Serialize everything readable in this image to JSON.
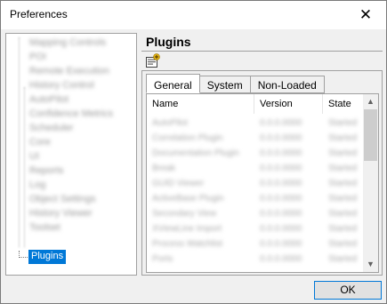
{
  "window": {
    "title": "Preferences",
    "close_glyph": "✕"
  },
  "tree": {
    "blurred_items": [
      "Mapping Controls",
      "POI",
      "Remote Execution",
      "History Control",
      "AutoPilot",
      "Confidence Metrics",
      "Scheduler",
      "Core",
      "UI",
      "Reports",
      "Log",
      "Object Settings",
      "History Viewer",
      "Toolset"
    ],
    "selected_label": "Plugins"
  },
  "panel": {
    "title": "Plugins",
    "tabs": [
      {
        "label": "General",
        "active": true
      },
      {
        "label": "System",
        "active": false
      },
      {
        "label": "Non-Loaded",
        "active": false
      }
    ],
    "columns": [
      "Name",
      "Version",
      "State"
    ],
    "rows": [
      {
        "name": "AutoPilot",
        "version": "0.0.0.0000",
        "state": "Started"
      },
      {
        "name": "Correlation Plugin",
        "version": "0.0.0.0000",
        "state": "Started"
      },
      {
        "name": "Documentation Plugin",
        "version": "0.0.0.0000",
        "state": "Started"
      },
      {
        "name": "Break",
        "version": "0.0.0.0000",
        "state": "Started"
      },
      {
        "name": "GUID Viewer",
        "version": "0.0.0.0000",
        "state": "Started"
      },
      {
        "name": "ActiveBase Plugin",
        "version": "0.0.0.0000",
        "state": "Started"
      },
      {
        "name": "Secondary View",
        "version": "0.0.0.0000",
        "state": "Started"
      },
      {
        "name": "XViewLine Import",
        "version": "0.0.0.0000",
        "state": "Started"
      },
      {
        "name": "Process Watchlist",
        "version": "0.0.0.0000",
        "state": "Started"
      },
      {
        "name": "Ports",
        "version": "0.0.0.0000",
        "state": "Started"
      }
    ]
  },
  "footer": {
    "ok_label": "OK"
  },
  "icons": {
    "scroll_up": "▲",
    "scroll_down": "▼"
  }
}
